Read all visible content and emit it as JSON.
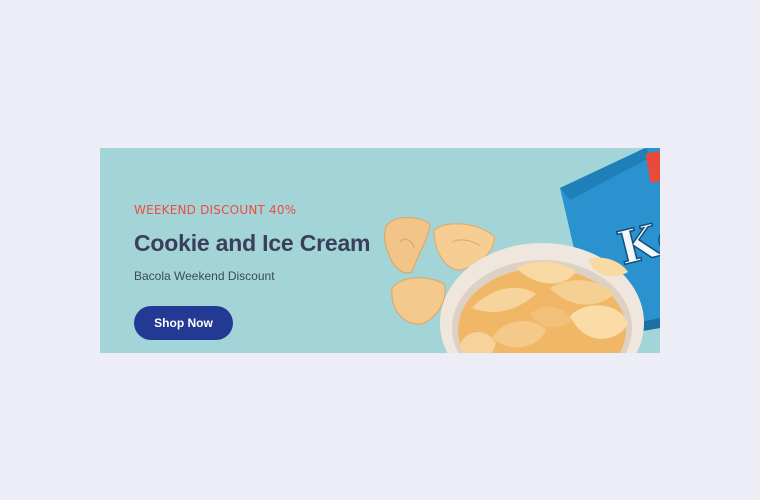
{
  "banner": {
    "eyebrow": "WEEKEND DISCOUNT 40%",
    "headline": "Cookie and Ice Cream",
    "subline": "Bacola Weekend Discount",
    "cta_label": "Shop Now",
    "bag_text": "Ke"
  },
  "colors": {
    "page_background": "#ecedf6",
    "banner_background": "#a2d4d8",
    "eyebrow": "#ef4b3f",
    "headline": "#3b3f5c",
    "button": "#233a95",
    "chips": "#f2c58a",
    "bag": "#2a93cf"
  }
}
